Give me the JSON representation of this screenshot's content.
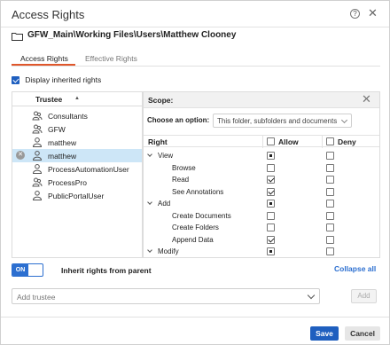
{
  "window": {
    "title": "Access Rights"
  },
  "path": "GFW_Main\\Working Files\\Users\\Matthew Clooney",
  "tabs": [
    {
      "label": "Access Rights",
      "active": true
    },
    {
      "label": "Effective Rights",
      "active": false
    }
  ],
  "display_inherited": {
    "label": "Display inherited rights",
    "checked": true
  },
  "trustee": {
    "header": "Trustee",
    "items": [
      {
        "name": "Consultants",
        "icon": "group-icon",
        "selected": false
      },
      {
        "name": "GFW",
        "icon": "group-icon",
        "selected": false
      },
      {
        "name": "matthew",
        "icon": "user-icon",
        "selected": false
      },
      {
        "name": "matthew",
        "icon": "user-icon",
        "selected": true
      },
      {
        "name": "ProcessAutomationUser",
        "icon": "user-icon",
        "selected": false
      },
      {
        "name": "ProcessPro",
        "icon": "group-icon",
        "selected": false
      },
      {
        "name": "PublicPortalUser",
        "icon": "user-icon",
        "selected": false
      }
    ]
  },
  "scope": {
    "title": "Scope:",
    "choose_label": "Choose an option:",
    "choose_value": "This folder, subfolders and documents"
  },
  "rights": {
    "col_right": "Right",
    "col_allow": "Allow",
    "col_deny": "Deny",
    "rows": [
      {
        "name": "View",
        "group": true,
        "allow": "partial",
        "deny": "none"
      },
      {
        "name": "Browse",
        "group": false,
        "allow": "none",
        "deny": "none"
      },
      {
        "name": "Read",
        "group": false,
        "allow": "checked",
        "deny": "none"
      },
      {
        "name": "See Annotations",
        "group": false,
        "allow": "checked",
        "deny": "none"
      },
      {
        "name": "Add",
        "group": true,
        "allow": "partial",
        "deny": "none"
      },
      {
        "name": "Create Documents",
        "group": false,
        "allow": "none",
        "deny": "none"
      },
      {
        "name": "Create Folders",
        "group": false,
        "allow": "none",
        "deny": "none"
      },
      {
        "name": "Append Data",
        "group": false,
        "allow": "checked",
        "deny": "none"
      },
      {
        "name": "Modify",
        "group": true,
        "allow": "partial",
        "deny": "none"
      }
    ]
  },
  "inherit": {
    "toggle_label": "ON",
    "label": "Inherit rights from parent",
    "collapse_label": "Collapse all"
  },
  "add_trustee": {
    "placeholder": "Add trustee",
    "button": "Add"
  },
  "footer": {
    "save": "Save",
    "cancel": "Cancel"
  },
  "colors": {
    "accent": "#1f5fbf",
    "tab_underline": "#e0572b",
    "selected_row": "#cde6f7"
  }
}
